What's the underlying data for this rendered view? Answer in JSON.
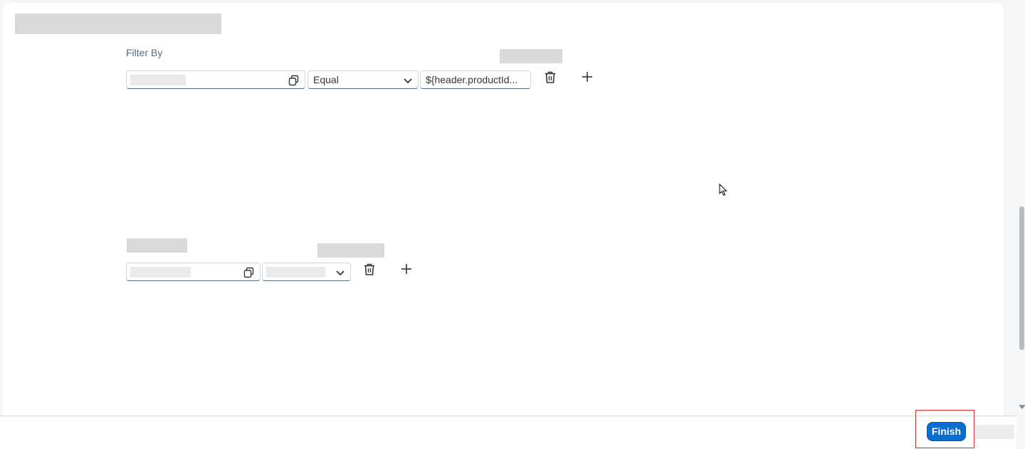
{
  "filter_section": {
    "label": "Filter By",
    "row": {
      "operator_value": "Equal",
      "value_text": "${header.productId..."
    }
  },
  "footer": {
    "finish_label": "Finish"
  },
  "icons": {
    "copy": "copy-icon",
    "dropdown": "chevron-down-icon",
    "delete": "trash-icon",
    "add": "plus-icon",
    "cursor": "mouse-pointer-icon"
  },
  "colors": {
    "accent": "#0a6ed1",
    "highlight": "#e0262b"
  }
}
